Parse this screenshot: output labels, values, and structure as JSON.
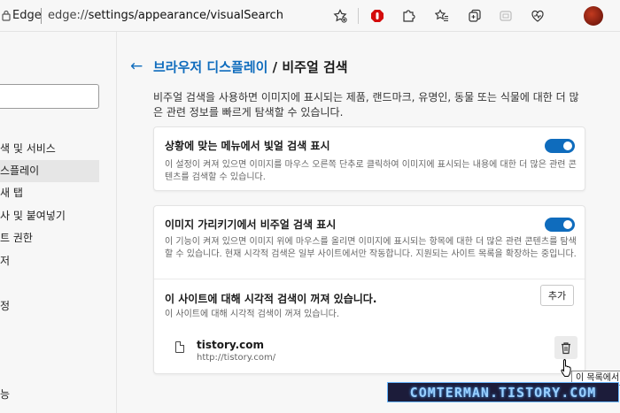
{
  "browser": {
    "brand": "Edge",
    "url_scheme": "edge://",
    "url_path": "settings/appearance/visualSearch"
  },
  "sidebar": {
    "items": [
      {
        "label": "색 및 서비스"
      },
      {
        "label": "스플레이"
      },
      {
        "label": "새 탭"
      },
      {
        "label": "사 및 붙여넣기"
      },
      {
        "label": "트 권한"
      },
      {
        "label": "저"
      },
      {
        "label": ""
      },
      {
        "label": "정"
      },
      {
        "label": ""
      },
      {
        "label": ""
      },
      {
        "label": "능"
      }
    ]
  },
  "main": {
    "breadcrumb": "브라우저 디스플레이",
    "title_sep": " / ",
    "title": "비주얼 검색",
    "description": "비주얼 검색을 사용하면 이미지에 표시되는 제품, 랜드마크, 유명인, 동물 또는 식물에 대한 더 많은 관련 정보를 빠르게 탐색할 수 있습니다."
  },
  "context_menu_card": {
    "title": "상황에 맞는 메뉴에서 빛얼 검색 표시",
    "description": "이 설정이 켜져 있으면 이미지를 마우스 오른쪽 단추로 클릭하여 이미지에 표시되는 내용에 대한 더 많은 관련 콘텐츠를 검색할 수 있습니다.",
    "enabled": true
  },
  "hover_card": {
    "title": "이미지 가리키기에서 비주얼 검색 표시",
    "description": "이 기능이 켜져 있으면 이미지 위에 마우스를 올리면 이미지에 표시되는 항목에 대한 더 많은 관련 콘텐츠를 탐색할 수 있습니다. 현재 시각적 검색은 일부 사이트에서만 작동합니다. 지원되는 사이트 목록을 확장하는 중입니다.",
    "enabled": true,
    "disabled_sites_title": "이 사이트에 대해 시각적 검색이 꺼져 있습니다.",
    "disabled_sites_subtitle": "이 사이트에 대해 시각적 검색이 꺼져 있습니다.",
    "add_label": "추가",
    "sites": [
      {
        "name": "tistory.com",
        "url": "http://tistory.com/"
      }
    ]
  },
  "tooltip": "이 목록에서",
  "watermark": "COMTERMAN.TISTORY.COM",
  "colors": {
    "accent": "#0f6cbd",
    "background": "#f7f7f7",
    "card": "#ffffff"
  },
  "icons": {
    "lock": "lock-icon",
    "favorites_add": "star-add-icon",
    "adblock": "stop-icon",
    "extensions": "puzzle-icon",
    "favorites": "favorites-icon",
    "collections": "collections-icon",
    "screenshot": "screenshot-icon",
    "browser_essentials": "heart-pulse-icon",
    "delete": "trash-icon"
  }
}
